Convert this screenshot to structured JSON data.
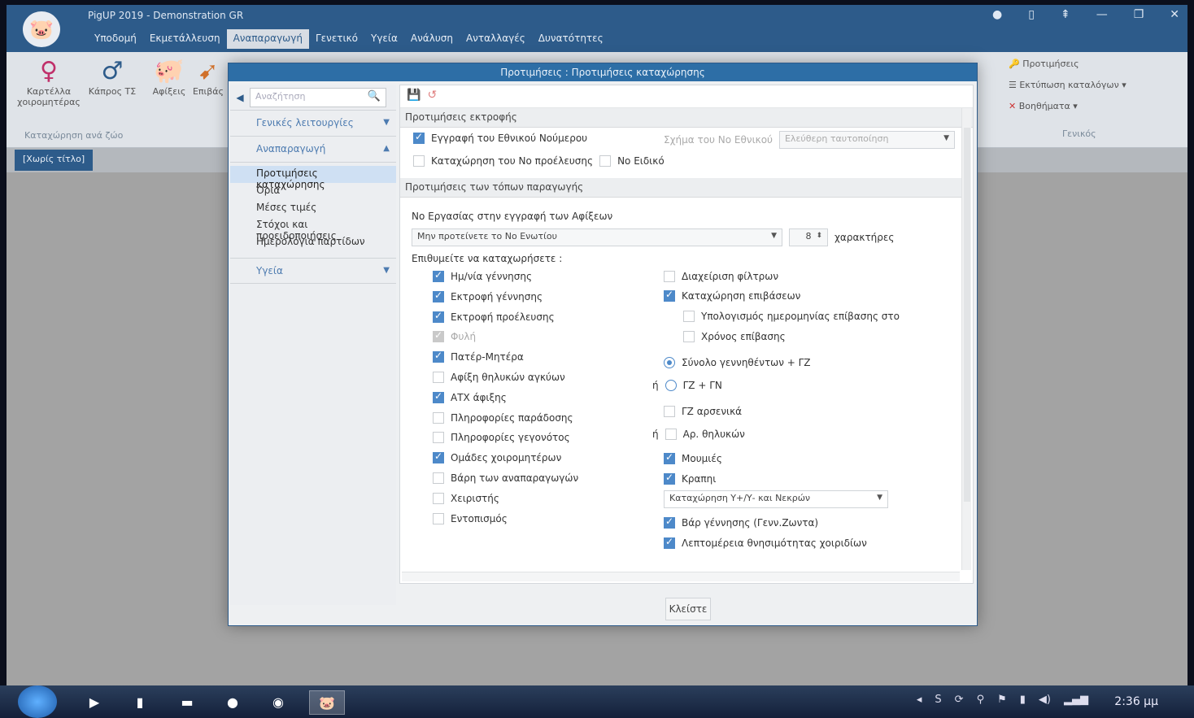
{
  "app": {
    "title": "PigUP 2019 - Demonstration GR",
    "menu": [
      "Υποδομή",
      "Εκμετάλλευση",
      "Αναπαραγωγή",
      "Γενετικό",
      "Υγεία",
      "Ανάλυση",
      "Ανταλλαγές",
      "Δυνατότητες"
    ],
    "active_menu": "Αναπαραγωγή"
  },
  "ribbon": {
    "btn_sow_card": "Καρτέλλα χοιρομητέρας",
    "btn_boar": "Κάπρος ΤΣ",
    "btn_arrivals": "Αφίξεις",
    "btn_visits": "Επιβάς",
    "group_label": "Καταχώρηση ανά ζώο",
    "right_prefs": "Προτιμήσεις",
    "right_print": "Εκτύπωση καταλόγων",
    "right_tools": "Βοηθήματα",
    "right_group": "Γενικός"
  },
  "doc_tab": "[Χωρίς τίτλο]",
  "dialog": {
    "title": "Προτιμήσεις : Προτιμήσεις καταχώρησης",
    "search_placeholder": "Αναζήτηση",
    "nav_general": "Γενικές λειτουργίες",
    "nav_repro": "Αναπαραγωγή",
    "nav_sub": [
      "Προτιμήσεις καταχώρησης",
      "Όρια",
      "Μέσες τιμές",
      "Στόχοι και προειδοποιήσεις",
      "Ημερολόγια παρτίδων"
    ],
    "nav_health": "Υγεία",
    "section_print": "Προτιμήσεις εκτροφής",
    "print_national_no": "Εγγραφή του Εθνικού Νούμερου",
    "print_predicted_no": "Καταχώρηση του Νο προέλευσης",
    "print_special_no": "Νο Ειδικό",
    "national_schema_label": "Σχήμα του Νο Εθνικού",
    "national_schema_value": "Ελεύθερη ταυτοποίηση",
    "section_production": "Προτιμήσεις των τόπων παραγωγής",
    "work_no_label": "Νο Εργασίας στην εγγραφή των Αφίξεων",
    "work_no_value": "Μην προτείνετε το Νο Ενωτίου",
    "chars_count": "8",
    "chars_label": "χαρακτήρες",
    "wish_label": "Επιθυμείτε να καταχωρήσετε :",
    "left_options": [
      {
        "label": "Ημ/νία γέννησης",
        "state": "on"
      },
      {
        "label": "Εκτροφή γέννησης",
        "state": "on"
      },
      {
        "label": "Εκτροφή προέλευσης",
        "state": "on"
      },
      {
        "label": "Φυλή",
        "state": "dis"
      },
      {
        "label": "Πατέρ-Μητέρα",
        "state": "on"
      },
      {
        "label": "Αφίξη θηλυκών αγκύων",
        "state": "off"
      },
      {
        "label": "ΑΤΧ άφιξης",
        "state": "on"
      },
      {
        "label": "Πληροφορίες παράδοσης",
        "state": "off"
      },
      {
        "label": "Πληροφορίες γεγονότος",
        "state": "off"
      },
      {
        "label": "Ομάδες χοιρομητέρων",
        "state": "on"
      },
      {
        "label": "Βάρη των αναπαραγωγών",
        "state": "off"
      },
      {
        "label": "Χειριστής",
        "state": "off"
      },
      {
        "label": "Εντοπισμός",
        "state": "off"
      }
    ],
    "mng_filters": "Διαχείριση φίλτρων",
    "reg_visits": "Καταχώρηση επιβάσεων",
    "calc_date": "Υπολογισμός ημερομηνίας επίβασης στο",
    "visit_time": "Χρόνος επίβασης",
    "radio_total": "Σύνολο γεννηθέντων + ΓΖ",
    "or_1": "ή",
    "radio_gz_gn": "ΓΖ + ΓΝ",
    "gz_males": "ΓΖ αρσενικά",
    "or_2": "ή",
    "num_females": "Αρ. θηλυκών",
    "mummies": "Μουμιές",
    "weak": "Κραπηι",
    "reg_select": "Καταχώρηση Υ+/Υ- και Νεκρών",
    "birth_weight": "Βάρ γέννησης (Γενν.Ζωντα)",
    "mortality_detail": "Λεπτομέρεια θνησιμότητας χοιριδίων",
    "close_btn": "Κλείστε"
  },
  "taskbar": {
    "clock": "2:36 μμ"
  },
  "colors": {
    "accent": "#2d5b8a",
    "check": "#4d89c9"
  }
}
